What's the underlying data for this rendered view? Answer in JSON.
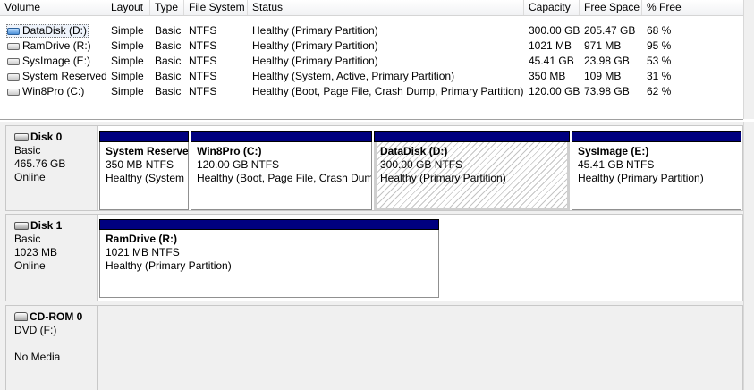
{
  "columns": {
    "volume": "Volume",
    "layout": "Layout",
    "type": "Type",
    "filesystem": "File System",
    "status": "Status",
    "capacity": "Capacity",
    "free_space": "Free Space",
    "pct_free": "% Free"
  },
  "volumes": [
    {
      "name": "DataDisk (D:)",
      "layout": "Simple",
      "type": "Basic",
      "fs": "NTFS",
      "status": "Healthy (Primary Partition)",
      "capacity": "300.00 GB",
      "free": "205.47 GB",
      "pct": "68 %",
      "icon": "blue-volume-icon"
    },
    {
      "name": "RamDrive (R:)",
      "layout": "Simple",
      "type": "Basic",
      "fs": "NTFS",
      "status": "Healthy (Primary Partition)",
      "capacity": "1021 MB",
      "free": "971 MB",
      "pct": "95 %",
      "icon": "drive-icon"
    },
    {
      "name": "SysImage (E:)",
      "layout": "Simple",
      "type": "Basic",
      "fs": "NTFS",
      "status": "Healthy (Primary Partition)",
      "capacity": "45.41 GB",
      "free": "23.98 GB",
      "pct": "53 %",
      "icon": "drive-icon"
    },
    {
      "name": "System Reserved",
      "layout": "Simple",
      "type": "Basic",
      "fs": "NTFS",
      "status": "Healthy (System, Active, Primary Partition)",
      "capacity": "350 MB",
      "free": "109 MB",
      "pct": "31 %",
      "icon": "drive-icon"
    },
    {
      "name": "Win8Pro (C:)",
      "layout": "Simple",
      "type": "Basic",
      "fs": "NTFS",
      "status": "Healthy (Boot, Page File, Crash Dump, Primary Partition)",
      "capacity": "120.00 GB",
      "free": "73.98 GB",
      "pct": "62 %",
      "icon": "drive-icon"
    }
  ],
  "disks": [
    {
      "name": "Disk 0",
      "kind": "Basic",
      "size": "465.76 GB",
      "state": "Online",
      "partitions": [
        {
          "name": "System Reserve",
          "size": "350 MB NTFS",
          "status": "Healthy (System"
        },
        {
          "name": "Win8Pro  (C:)",
          "size": "120.00 GB NTFS",
          "status": "Healthy (Boot, Page File, Crash Dum"
        },
        {
          "name": "DataDisk  (D:)",
          "size": "300.00 GB NTFS",
          "status": "Healthy (Primary Partition)"
        },
        {
          "name": "SysImage  (E:)",
          "size": "45.41 GB NTFS",
          "status": "Healthy (Primary Partition)"
        }
      ]
    },
    {
      "name": "Disk 1",
      "kind": "Basic",
      "size": "1023 MB",
      "state": "Online",
      "partitions": [
        {
          "name": "RamDrive  (R:)",
          "size": "1021 MB NTFS",
          "status": "Healthy (Primary Partition)"
        }
      ]
    },
    {
      "name": "CD-ROM 0",
      "kind": "DVD (F:)",
      "state": "No Media"
    }
  ],
  "colors": {
    "partition_bar": "#00007f",
    "pane_background": "#f0f0f0"
  }
}
